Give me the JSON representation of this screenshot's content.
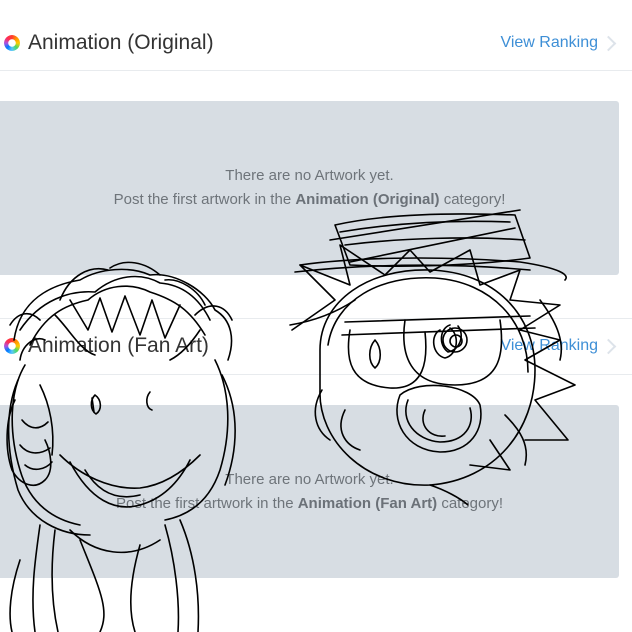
{
  "sections": [
    {
      "title": "Animation (Original)",
      "ranking_label": "View Ranking",
      "empty_line1": "There are no Artwork yet.",
      "empty_prefix": "Post the first artwork in the",
      "empty_category": "Animation (Original)",
      "empty_suffix": "category!"
    },
    {
      "title": "Animation (Fan Art)",
      "ranking_label": "View Ranking",
      "empty_line1": "There are no Artwork yet.",
      "empty_prefix": "Post the first artwork in the",
      "empty_category": "Animation (Fan Art)",
      "empty_suffix": "category!"
    }
  ],
  "icons": {
    "category": "color-ring-icon",
    "ranking": "chevron-right-icon"
  },
  "colors": {
    "link": "#3e8fd6",
    "empty_bg": "#d7dde3",
    "text_muted": "#6e747a",
    "ink": "#000000"
  },
  "overlay": "hand-drawn-sketch"
}
